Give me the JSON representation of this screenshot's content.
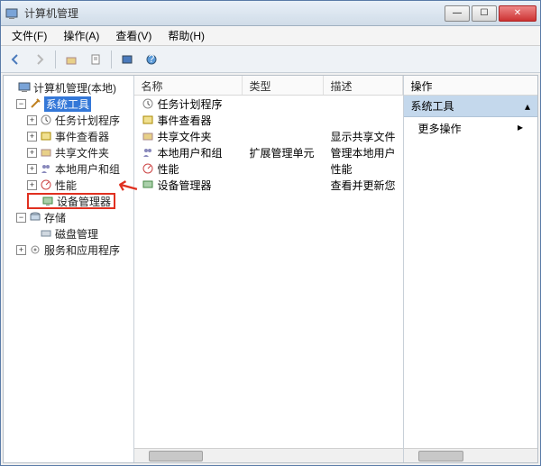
{
  "window": {
    "title": "计算机管理"
  },
  "menu": {
    "file": "文件(F)",
    "action": "操作(A)",
    "view": "查看(V)",
    "help": "帮助(H)"
  },
  "tree": {
    "root": "计算机管理(本地)",
    "sys_tools": "系统工具",
    "task_sched": "任务计划程序",
    "event_viewer": "事件查看器",
    "shared": "共享文件夹",
    "local_users": "本地用户和组",
    "perf": "性能",
    "dev_mgr": "设备管理器",
    "storage": "存储",
    "disk_mgmt": "磁盘管理",
    "services": "服务和应用程序"
  },
  "columns": {
    "name": "名称",
    "type": "类型",
    "desc": "描述"
  },
  "rows": [
    {
      "name": "任务计划程序",
      "type": "",
      "desc": ""
    },
    {
      "name": "事件查看器",
      "type": "",
      "desc": ""
    },
    {
      "name": "共享文件夹",
      "type": "",
      "desc": "显示共享文件"
    },
    {
      "name": "本地用户和组",
      "type": "扩展管理单元",
      "desc": "管理本地用户"
    },
    {
      "name": "性能",
      "type": "",
      "desc": "性能"
    },
    {
      "name": "设备管理器",
      "type": "",
      "desc": "查看并更新您"
    }
  ],
  "actions": {
    "header": "操作",
    "section": "系统工具",
    "more": "更多操作"
  }
}
